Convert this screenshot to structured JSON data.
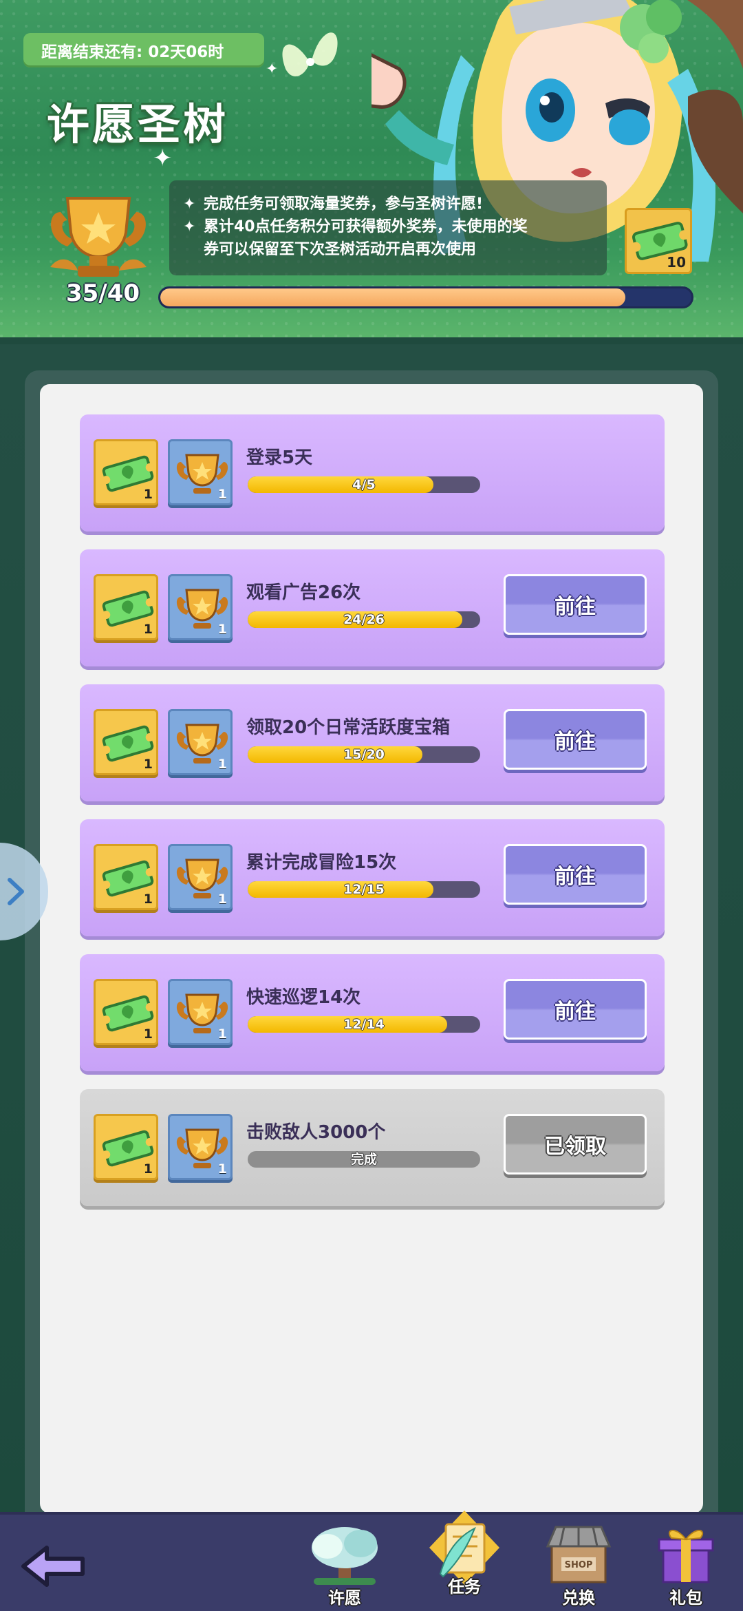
{
  "event": {
    "timer_text": "距离结束还有: 02天06时",
    "title": "许愿圣树",
    "info_line1": "完成任务可领取海量奖券，参与圣树许愿!",
    "info_line2a": "累计40点任务积分可获得额外奖券，未使用的奖",
    "info_line2b": "券可以保留至下次圣树活动开启再次使用",
    "info_star": "✦",
    "ticket_count": "10",
    "score_text": "35/40",
    "score_current": 35,
    "score_total": 40
  },
  "tasks": [
    {
      "title": "登录5天",
      "progress_text": "4/5",
      "current": 4,
      "total": 5,
      "ticket_qty": "1",
      "cup_qty": "1",
      "button": ""
    },
    {
      "title": "观看广告26次",
      "progress_text": "24/26",
      "current": 24,
      "total": 26,
      "ticket_qty": "1",
      "cup_qty": "1",
      "button": "前往"
    },
    {
      "title": "领取20个日常活跃度宝箱",
      "progress_text": "15/20",
      "current": 15,
      "total": 20,
      "ticket_qty": "1",
      "cup_qty": "1",
      "button": "前往"
    },
    {
      "title": "累计完成冒险15次",
      "progress_text": "12/15",
      "current": 12,
      "total": 15,
      "ticket_qty": "1",
      "cup_qty": "1",
      "button": "前往"
    },
    {
      "title": "快速巡逻14次",
      "progress_text": "12/14",
      "current": 12,
      "total": 14,
      "ticket_qty": "1",
      "cup_qty": "1",
      "button": "前往"
    },
    {
      "title": "击败敌人3000个",
      "progress_text": "完成",
      "current": 0,
      "total": 1,
      "ticket_qty": "1",
      "cup_qty": "1",
      "button": "已领取"
    }
  ],
  "nav": {
    "wish": "许愿",
    "tasks": "任务",
    "exchange": "兑换",
    "gift": "礼包",
    "shop_sign": "SHOP"
  },
  "colors": {
    "task_bg": "#c8a2f7",
    "done_bg": "#cacaca",
    "progress_fill": "#f3b800",
    "main_bar_fill": "#f5a85e",
    "go_button": "#8c86e0"
  },
  "icons": {
    "ticket": "green-ticket-icon",
    "cup": "trophy-cup-icon",
    "back": "back-arrow-icon",
    "side": "chevron-right-icon"
  }
}
